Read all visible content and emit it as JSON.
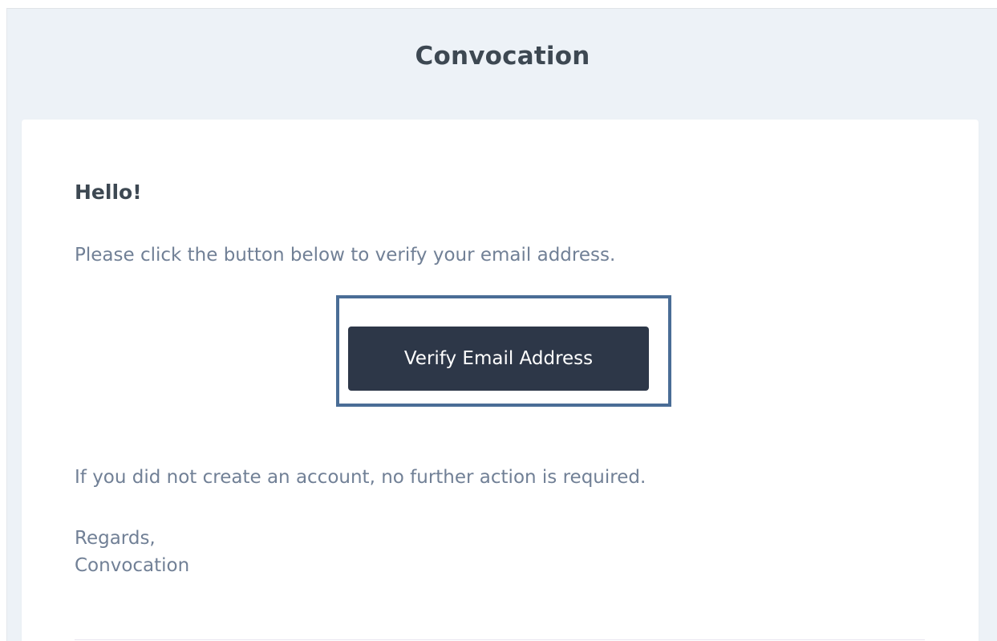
{
  "header": {
    "app_name": "Convocation"
  },
  "email": {
    "greeting": "Hello!",
    "intro": "Please click the button below to verify your email address.",
    "action_label": "Verify Email Address",
    "outro": "If you did not create an account, no further action is required.",
    "salutation": "Regards,",
    "signature": "Convocation"
  },
  "colors": {
    "background": "#edf2f7",
    "card": "#ffffff",
    "heading_text": "#3d4852",
    "body_text": "#718096",
    "button_bg": "#2d3748",
    "button_text": "#ffffff",
    "highlight_border": "#4a6d96"
  }
}
